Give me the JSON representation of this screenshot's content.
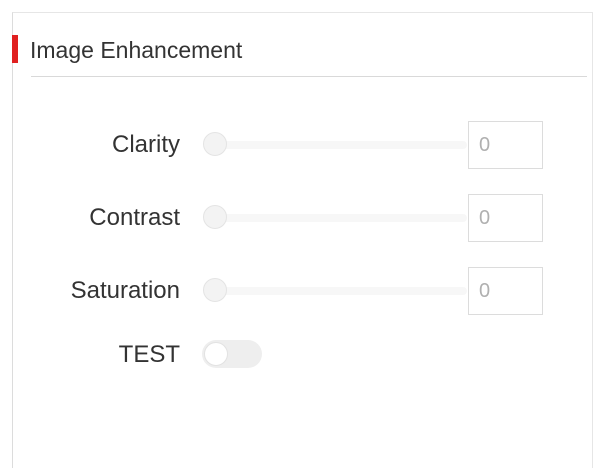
{
  "panel": {
    "title": "Image Enhancement",
    "accent_color": "#e02020"
  },
  "settings": [
    {
      "label": "Clarity",
      "value": "0",
      "level": 0
    },
    {
      "label": "Contrast",
      "value": "0",
      "level": 0
    },
    {
      "label": "Saturation",
      "value": "0",
      "level": 0
    }
  ],
  "test_toggle": {
    "label": "TEST",
    "enabled": false
  }
}
